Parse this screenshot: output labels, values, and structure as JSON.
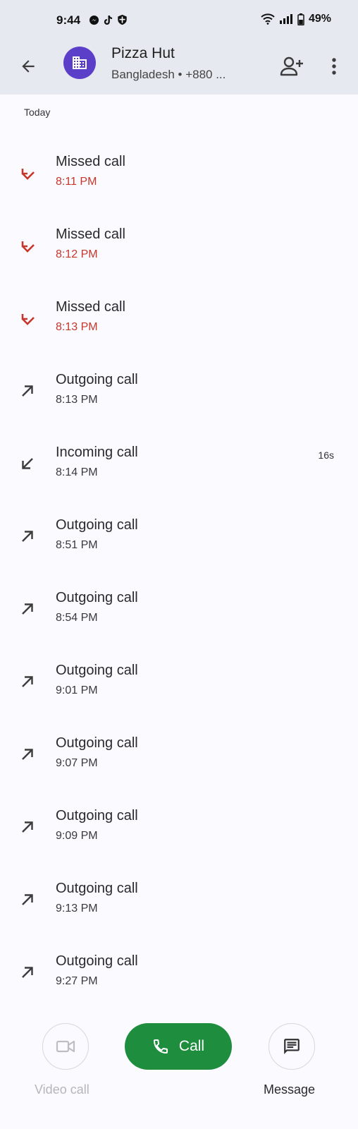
{
  "status_bar": {
    "time": "9:44",
    "battery": "49%"
  },
  "header": {
    "contact_name": "Pizza Hut",
    "contact_subtitle": "Bangladesh • +880 ..."
  },
  "section_label": "Today",
  "calls": [
    {
      "type": "Missed call",
      "time": "8:11 PM",
      "kind": "missed",
      "duration": ""
    },
    {
      "type": "Missed call",
      "time": "8:12 PM",
      "kind": "missed",
      "duration": ""
    },
    {
      "type": "Missed call",
      "time": "8:13 PM",
      "kind": "missed",
      "duration": ""
    },
    {
      "type": "Outgoing call",
      "time": "8:13 PM",
      "kind": "outgoing",
      "duration": ""
    },
    {
      "type": "Incoming call",
      "time": "8:14 PM",
      "kind": "incoming",
      "duration": "16s"
    },
    {
      "type": "Outgoing call",
      "time": "8:51 PM",
      "kind": "outgoing",
      "duration": ""
    },
    {
      "type": "Outgoing call",
      "time": "8:54 PM",
      "kind": "outgoing",
      "duration": ""
    },
    {
      "type": "Outgoing call",
      "time": "9:01 PM",
      "kind": "outgoing",
      "duration": ""
    },
    {
      "type": "Outgoing call",
      "time": "9:07 PM",
      "kind": "outgoing",
      "duration": ""
    },
    {
      "type": "Outgoing call",
      "time": "9:09 PM",
      "kind": "outgoing",
      "duration": ""
    },
    {
      "type": "Outgoing call",
      "time": "9:13 PM",
      "kind": "outgoing",
      "duration": ""
    },
    {
      "type": "Outgoing call",
      "time": "9:27 PM",
      "kind": "outgoing",
      "duration": ""
    }
  ],
  "actions": {
    "call_label": "Call",
    "video_label": "Video call",
    "message_label": "Message"
  },
  "colors": {
    "missed": "#c5362b",
    "call_button": "#1e8e3e",
    "avatar": "#5c3fc8"
  },
  "icons": {
    "back": "arrow-back-icon",
    "avatar": "building-icon",
    "add_contact": "person-add-icon",
    "more": "more-vert-icon",
    "missed": "missed-call-icon",
    "outgoing": "call-made-icon",
    "incoming": "call-received-icon",
    "video": "videocam-icon",
    "call": "phone-icon",
    "message": "message-icon"
  }
}
